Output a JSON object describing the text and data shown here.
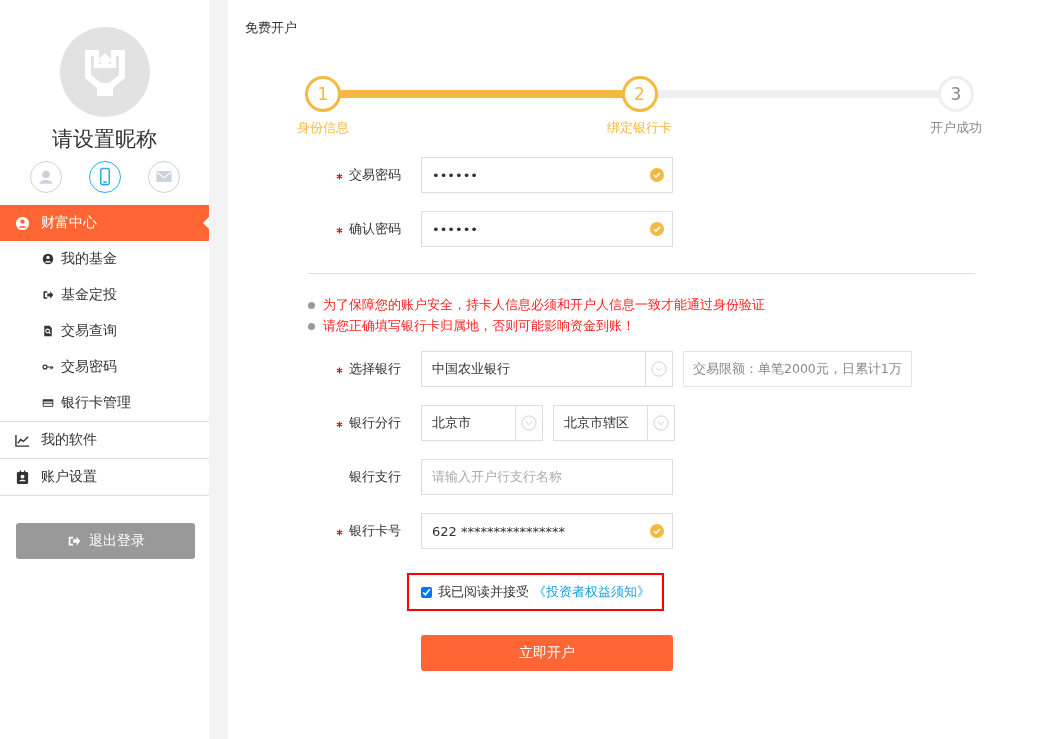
{
  "sidebar": {
    "nickname": "请设置昵称",
    "contacts": [
      {
        "selected": false
      },
      {
        "selected": true
      },
      {
        "selected": false
      }
    ],
    "menu": [
      {
        "label": "财富中心",
        "selected": true,
        "children": [
          {
            "label": "我的基金"
          },
          {
            "label": "基金定投"
          },
          {
            "label": "交易查询"
          },
          {
            "label": "交易密码"
          },
          {
            "label": "银行卡管理"
          }
        ]
      },
      {
        "label": "我的软件",
        "selected": false
      },
      {
        "label": "账户设置",
        "selected": false
      }
    ],
    "logout": "退出登录"
  },
  "main": {
    "title": "免费开户",
    "steps": [
      {
        "number": "1",
        "label": "身份信息",
        "completed": true
      },
      {
        "number": "2",
        "label": "绑定银行卡",
        "completed": true
      },
      {
        "number": "3",
        "label": "开户成功",
        "completed": false
      }
    ],
    "password_fields": [
      {
        "label": "交易密码",
        "required": true,
        "value": "••••••",
        "valid": true
      },
      {
        "label": "确认密码",
        "required": true,
        "value": "••••••",
        "valid": true
      }
    ],
    "notes": [
      "为了保障您的账户安全，持卡人信息必须和开户人信息一致才能通过身份验证",
      "请您正确填写银行卡归属地，否则可能影响资金到账！"
    ],
    "bank_fields": [
      {
        "kind": "select",
        "label": "选择银行",
        "required": true,
        "value": "中国农业银行",
        "hint": "交易限额：单笔2000元，日累计1万"
      },
      {
        "kind": "select_pair",
        "label": "银行分行",
        "required": true,
        "values": [
          "北京市",
          "北京市辖区"
        ]
      },
      {
        "kind": "text",
        "label": "银行支行",
        "required": false,
        "placeholder": "请输入开户行支行名称"
      },
      {
        "kind": "text",
        "label": "银行卡号",
        "required": true,
        "value": "622 ****************",
        "valid": true
      }
    ],
    "agreement": {
      "checked": true,
      "highlighted": true,
      "text": "我已阅读并接受",
      "link": "《投资者权益须知》"
    },
    "submit": "立即开户"
  }
}
